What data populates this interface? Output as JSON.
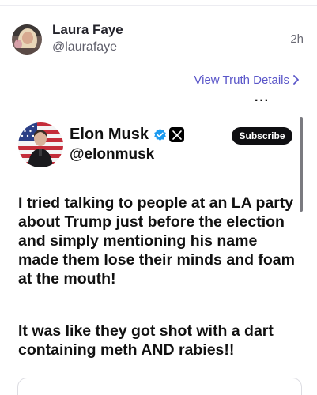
{
  "post": {
    "author_name": "Laura Faye",
    "author_handle": "@laurafaye",
    "time": "2h",
    "view_details_label": "View Truth Details",
    "more_menu": "···"
  },
  "embed": {
    "author_name": "Elon Musk",
    "author_handle": "@elonmusk",
    "subscribe_label": "Subscribe",
    "paragraphs": [
      "I tried talking to people at an LA party about Trump just before the election and simply mentioning his name made them lose their minds and foam at the mouth!",
      "It was like they got shot with a dart containing meth AND rabies!!"
    ]
  },
  "colors": {
    "link": "#5a56c9",
    "verified": "#1d9bf0",
    "subscribe_bg": "#0f0f12"
  },
  "icons": {
    "verified": "verified-badge-icon",
    "x_logo": "x-logo-icon",
    "chevron": "chevron-right-icon"
  }
}
